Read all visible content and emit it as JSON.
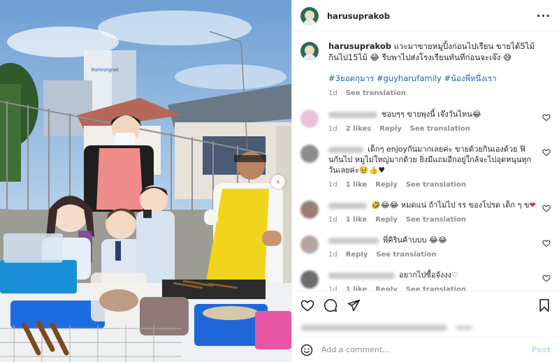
{
  "post": {
    "username": "harusuprakob",
    "caption": "แวะมาขายหมูปิ้งก่อนไปเรียน ขายได้5ไม้ กินไป15ไม้ 😂 รีบพาไปส่งโรงเรียนทันทีก่อนจะเจ๊ง 😅",
    "hashtags": "#3ยอดกุมาร #guyharufamily #น้องพี่หนึ่งเรา",
    "time": "1d",
    "see_translation": "See translation"
  },
  "comments": [
    {
      "text": "ชอบๆๆ ขายพุงนี้ เจ๊งวันไหน😂",
      "time": "1d",
      "likes": "2 likes",
      "reply": "Reply",
      "translate": "See translation",
      "avatar_color": "#e6c3d9"
    },
    {
      "text": "เด็กๆ enjoyกันมากเลยค่ะ ขายด้วยกินเองด้วย ฟินกันไป หมูไม่ใหญ่มากด้วย ยิ่งมีแถมอีกอยู่ใกล้จะไปอุดหนุนทุกวันเลยค่ะ🥹👍♥",
      "time": "1d",
      "likes": "1 like",
      "reply": "Reply",
      "translate": "See translation",
      "avatar_color": "#8c8c8c"
    },
    {
      "text": "🤣😂😂 หมดแน่ ถ้าไม่ไป รร ของโปรด เด็ก ๆ ข",
      "heart_emoji": "❤",
      "time": "1d",
      "likes": "1 like",
      "reply": "Reply",
      "translate": "See translation",
      "avatar_color": "#9a7d74"
    },
    {
      "text": "พี่คิรินค้าบบบ 😂😂",
      "time": "1d",
      "reply": "Reply",
      "translate": "See translation",
      "avatar_color": "#b7a5a0"
    },
    {
      "text": "อยากไปซื้อจังงง♡",
      "time": "1d",
      "likes": "1 like",
      "reply": "Reply",
      "translate": "See translation",
      "avatar_color": "#6d6d6d"
    }
  ],
  "add_comment": {
    "placeholder": "Add a comment...",
    "post_label": "Post"
  },
  "photo": {
    "hospital_sign": "Bumrungrad"
  },
  "colors": {
    "link": "#1f63b5",
    "muted": "#8e8e8e",
    "post_disabled": "#b2dffc"
  }
}
